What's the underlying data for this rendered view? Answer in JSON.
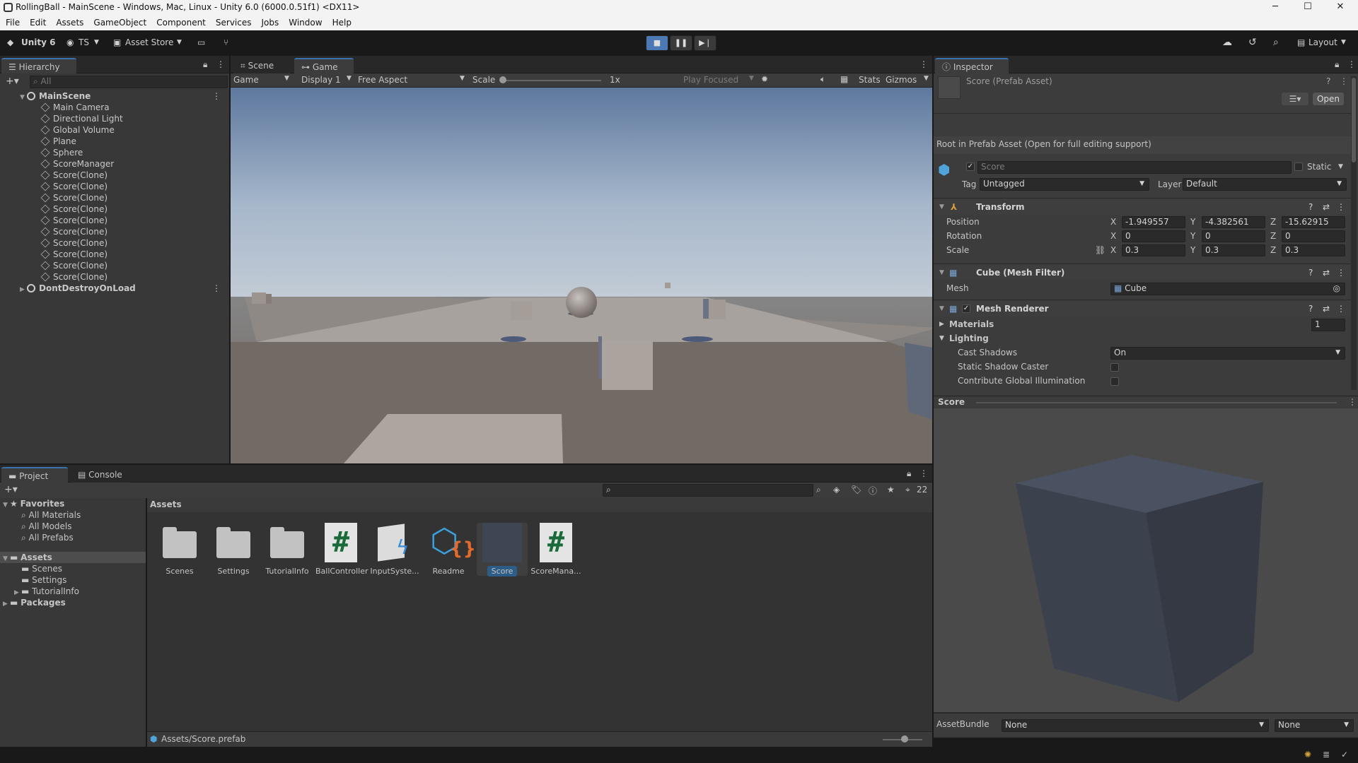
{
  "window": {
    "title": "RollingBall - MainScene - Windows, Mac, Linux - Unity 6.0 (6000.0.51f1) <DX11>",
    "minimize": "─",
    "maximize": "☐",
    "close": "✕"
  },
  "menu": [
    "File",
    "Edit",
    "Assets",
    "GameObject",
    "Component",
    "Services",
    "Jobs",
    "Window",
    "Help"
  ],
  "toolbar": {
    "unity_label": "Unity 6",
    "account": "TS",
    "asset_store": "Asset Store",
    "layout": "Layout"
  },
  "hierarchy": {
    "tab": "Hierarchy",
    "search_placeholder": "All",
    "items": [
      {
        "label": "MainScene",
        "level": 0,
        "kind": "scene"
      },
      {
        "label": "Main Camera",
        "level": 1,
        "kind": "object"
      },
      {
        "label": "Directional Light",
        "level": 1,
        "kind": "object"
      },
      {
        "label": "Global Volume",
        "level": 1,
        "kind": "object"
      },
      {
        "label": "Plane",
        "level": 1,
        "kind": "object"
      },
      {
        "label": "Sphere",
        "level": 1,
        "kind": "object"
      },
      {
        "label": "ScoreManager",
        "level": 1,
        "kind": "object"
      },
      {
        "label": "Score(Clone)",
        "level": 1,
        "kind": "object"
      },
      {
        "label": "Score(Clone)",
        "level": 1,
        "kind": "object"
      },
      {
        "label": "Score(Clone)",
        "level": 1,
        "kind": "object"
      },
      {
        "label": "Score(Clone)",
        "level": 1,
        "kind": "object"
      },
      {
        "label": "Score(Clone)",
        "level": 1,
        "kind": "object"
      },
      {
        "label": "Score(Clone)",
        "level": 1,
        "kind": "object"
      },
      {
        "label": "Score(Clone)",
        "level": 1,
        "kind": "object"
      },
      {
        "label": "Score(Clone)",
        "level": 1,
        "kind": "object"
      },
      {
        "label": "Score(Clone)",
        "level": 1,
        "kind": "object"
      },
      {
        "label": "Score(Clone)",
        "level": 1,
        "kind": "object"
      },
      {
        "label": "DontDestroyOnLoad",
        "level": 0,
        "kind": "scene"
      }
    ]
  },
  "game": {
    "tabs": [
      "Scene",
      "Game"
    ],
    "view_mode": "Game",
    "display": "Display 1",
    "aspect": "Free Aspect",
    "scale_label": "Scale",
    "scale_value": "1x",
    "play_focused": "Play Focused",
    "stats": "Stats",
    "gizmos": "Gizmos"
  },
  "inspector": {
    "tab": "Inspector",
    "asset_title": "Score (Prefab Asset)",
    "open": "Open",
    "notice": "Root in Prefab Asset (Open for full editing support)",
    "name": "Score",
    "static": "Static",
    "tag_label": "Tag",
    "tag": "Untagged",
    "layer_label": "Layer",
    "layer": "Default",
    "transform": {
      "title": "Transform",
      "position": {
        "label": "Position",
        "x": "-1.949557",
        "y": "-4.382561",
        "z": "-15.62915"
      },
      "rotation": {
        "label": "Rotation",
        "x": "0",
        "y": "0",
        "z": "0"
      },
      "scale": {
        "label": "Scale",
        "x": "0.3",
        "y": "0.3",
        "z": "0.3"
      }
    },
    "mesh_filter": {
      "title": "Cube (Mesh Filter)",
      "mesh_label": "Mesh",
      "mesh": "Cube"
    },
    "mesh_renderer": {
      "title": "Mesh Renderer",
      "materials": "Materials",
      "materials_count": "1",
      "lighting": "Lighting",
      "cast_shadows_label": "Cast Shadows",
      "cast_shadows": "On",
      "static_shadow": "Static Shadow Caster",
      "contribute_gi": "Contribute Global Illumination"
    },
    "preview_title": "Score",
    "assetbundle_label": "AssetBundle",
    "assetbundle": "None",
    "assetbundle_variant": "None"
  },
  "project": {
    "tabs": [
      "Project",
      "Console"
    ],
    "favorites": "Favorites",
    "fav_items": [
      "All Materials",
      "All Models",
      "All Prefabs"
    ],
    "assets_root": "Assets",
    "asset_folders": [
      "Scenes",
      "Settings",
      "TutorialInfo"
    ],
    "packages": "Packages",
    "breadcrumb": "Assets",
    "hidden_count": "22",
    "items": [
      {
        "label": "Scenes",
        "type": "folder"
      },
      {
        "label": "Settings",
        "type": "folder"
      },
      {
        "label": "TutorialInfo",
        "type": "folder"
      },
      {
        "label": "BallController",
        "type": "script"
      },
      {
        "label": "InputSyste...",
        "type": "input"
      },
      {
        "label": "Readme",
        "type": "readme"
      },
      {
        "label": "Score",
        "type": "prefab"
      },
      {
        "label": "ScoreMana...",
        "type": "script"
      }
    ],
    "status_path": "Assets/Score.prefab"
  },
  "colors": {
    "accent": "#3a72b0",
    "selected": "#2c5d87",
    "bg": "#383838"
  }
}
